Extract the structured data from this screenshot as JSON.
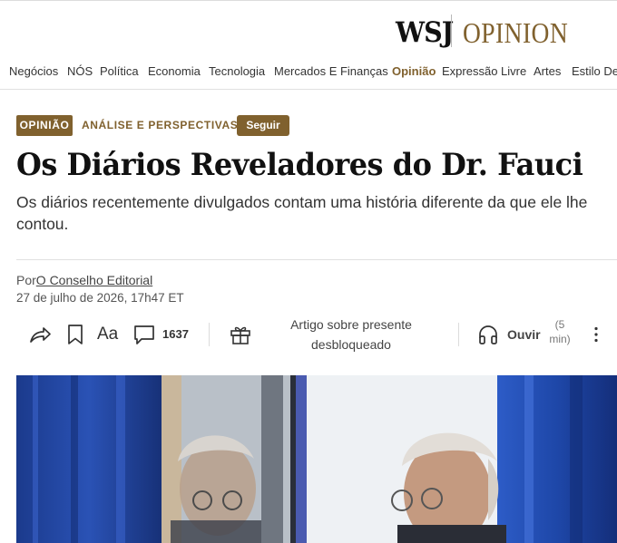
{
  "masthead": {
    "brand": "WSJ",
    "section": "OPINION"
  },
  "nav": {
    "items": [
      {
        "label": "Negócios",
        "active": false
      },
      {
        "label": "NÓS",
        "active": false
      },
      {
        "label": "Política",
        "active": false
      },
      {
        "label": "Economia",
        "active": false
      },
      {
        "label": "Tecnologia",
        "active": false
      },
      {
        "label": "Mercados E Finanças",
        "active": false
      },
      {
        "label": "Opinião",
        "active": true
      },
      {
        "label": "Expressão Livre",
        "active": false
      },
      {
        "label": "Artes",
        "active": false
      },
      {
        "label": "Estilo De",
        "active": false
      }
    ]
  },
  "article": {
    "tag": "OPINIÃO",
    "section": "ANÁLISE E PERSPECTIVAS",
    "follow_label": "Seguir",
    "headline": "Os Diários Reveladores do Dr. Fauci",
    "dek": "Os diários recentemente divulgados contam uma história diferente da que ele lhe contou.",
    "byline_prefix": "Por",
    "author": "O Conselho Editorial",
    "timestamp": "27 de julho de 2026, 17h47 ET"
  },
  "toolbar": {
    "comment_count": "1637",
    "font_size_label": "Aa",
    "gift_line1": "Artigo sobre presente",
    "gift_line2": "desbloqueado",
    "listen_label": "Ouvir",
    "listen_duration_line1": "(5",
    "listen_duration_line2": "min)"
  },
  "icons": {
    "share": "share-icon",
    "bookmark": "bookmark-icon",
    "text_size": "text-size-icon",
    "comment": "comment-icon",
    "gift": "gift-icon",
    "headphones": "headphones-icon",
    "more": "more-vertical-icon"
  },
  "colors": {
    "accent": "#80612e",
    "text": "#111111",
    "muted": "#555555"
  }
}
